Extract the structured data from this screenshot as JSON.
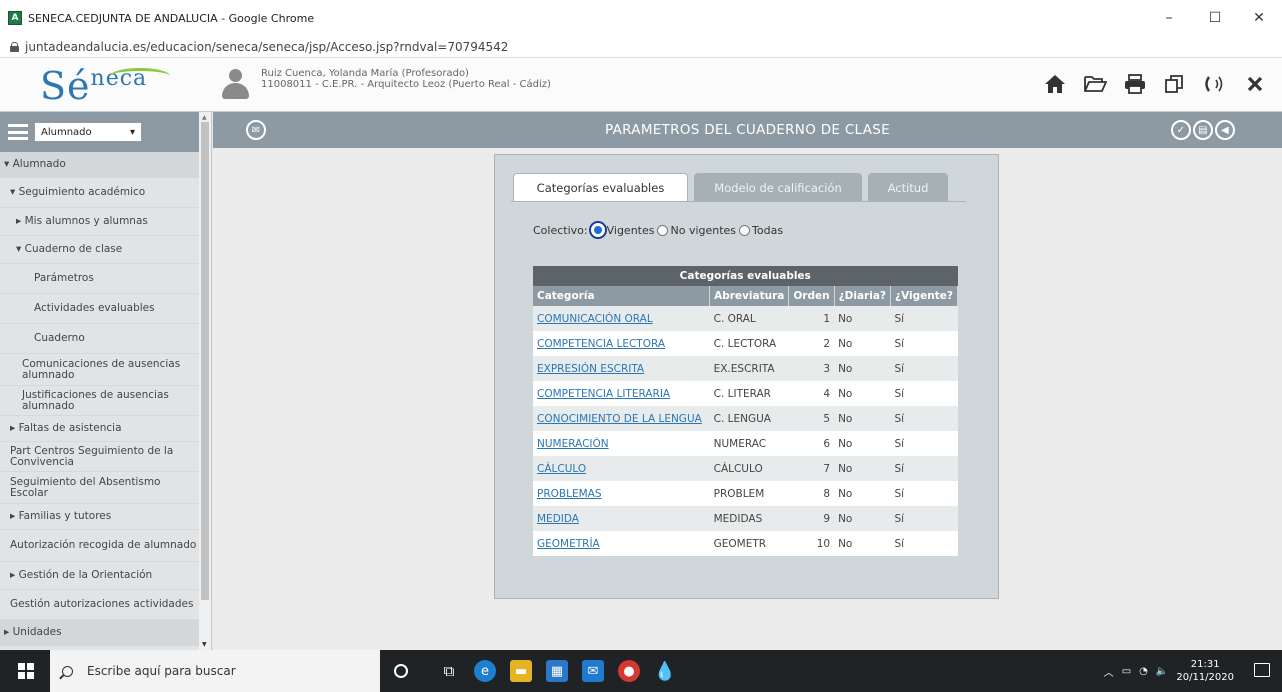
{
  "window": {
    "title": "SENECA.CEDJUNTA DE ANDALUCIA - Google Chrome",
    "url": "juntadeandalucia.es/educacion/seneca/seneca/jsp/Acceso.jsp?rndval=70794542",
    "minimize": "–",
    "maximize": "☐",
    "close": "✕"
  },
  "header": {
    "logo_main": "Sé",
    "logo_sup": "neca",
    "user_line1": "Ruiz Cuenca, Yolanda María (Profesorado)",
    "user_line2": "11008011 - C.E.PR. - Arquitecto Leoz (Puerto Real - Cádiz)",
    "icons": [
      "home-icon",
      "folder-icon",
      "print-icon",
      "copy-icon",
      "broadcast-icon",
      "close-icon"
    ]
  },
  "sidebar": {
    "selected": "Alumnado",
    "items": [
      {
        "label": "▾ Alumnado"
      },
      {
        "label": "▾ Seguimiento académico"
      },
      {
        "label": "▸ Mis alumnos y alumnas"
      },
      {
        "label": "▾ Cuaderno de clase"
      },
      {
        "label": "Parámetros"
      },
      {
        "label": "Actividades evaluables"
      },
      {
        "label": "Cuaderno"
      },
      {
        "label": "Comunicaciones de ausencias alumnado"
      },
      {
        "label": "Justificaciones de ausencias alumnado"
      },
      {
        "label": "▸ Faltas de asistencia"
      },
      {
        "label": "Part Centros Seguimiento de la Convivencia"
      },
      {
        "label": "Seguimiento del Absentismo Escolar"
      },
      {
        "label": "▸ Familias y tutores"
      },
      {
        "label": "Autorización recogida de alumnado"
      },
      {
        "label": "▸ Gestión de la Orientación"
      },
      {
        "label": "Gestión autorizaciones actividades"
      },
      {
        "label": "▸ Unidades"
      }
    ]
  },
  "page": {
    "title": "PARAMETROS DEL CUADERNO DE CLASE"
  },
  "tabs": [
    {
      "label": "Categorías evaluables",
      "active": true
    },
    {
      "label": "Modelo de calificación",
      "active": false
    },
    {
      "label": "Actitud",
      "active": false
    }
  ],
  "filter": {
    "label": "Colectivo:",
    "options": [
      "Vigentes",
      "No vigentes",
      "Todas"
    ],
    "selected": "Vigentes"
  },
  "table": {
    "caption": "Categorías evaluables",
    "headers": [
      "Categoría",
      "Abreviatura",
      "Orden",
      "¿Diaria?",
      "¿Vigente?"
    ],
    "rows": [
      [
        "COMUNICACIÓN ORAL",
        "C. ORAL",
        "1",
        "No",
        "Sí"
      ],
      [
        "COMPETENCIA LECTORA",
        "C. LECTORA",
        "2",
        "No",
        "Sí"
      ],
      [
        "EXPRESIÓN ESCRITA",
        "EX.ESCRITA",
        "3",
        "No",
        "Sí"
      ],
      [
        "COMPETENCIA LITERARIA",
        "C. LITERAR",
        "4",
        "No",
        "Sí"
      ],
      [
        "CONOCIMIENTO DE LA LENGUA",
        "C. LENGUA",
        "5",
        "No",
        "Sí"
      ],
      [
        "NUMERACIÓN",
        "NUMERAC",
        "6",
        "No",
        "Sí"
      ],
      [
        "CÁLCULO",
        "CÁLCULO",
        "7",
        "No",
        "Sí"
      ],
      [
        "PROBLEMAS",
        "PROBLEM",
        "8",
        "No",
        "Sí"
      ],
      [
        "MEDIDA",
        "MEDIDAS",
        "9",
        "No",
        "Sí"
      ],
      [
        "GEOMETRÍA",
        "GEOMETR",
        "10",
        "No",
        "Sí"
      ]
    ]
  },
  "taskbar": {
    "search_placeholder": "Escribe aquí para buscar",
    "time": "21:31",
    "date": "20/11/2020"
  },
  "colors": {
    "accent": "#2a77b4",
    "bar": "#8d9aa3",
    "green": "#8dc63f"
  }
}
